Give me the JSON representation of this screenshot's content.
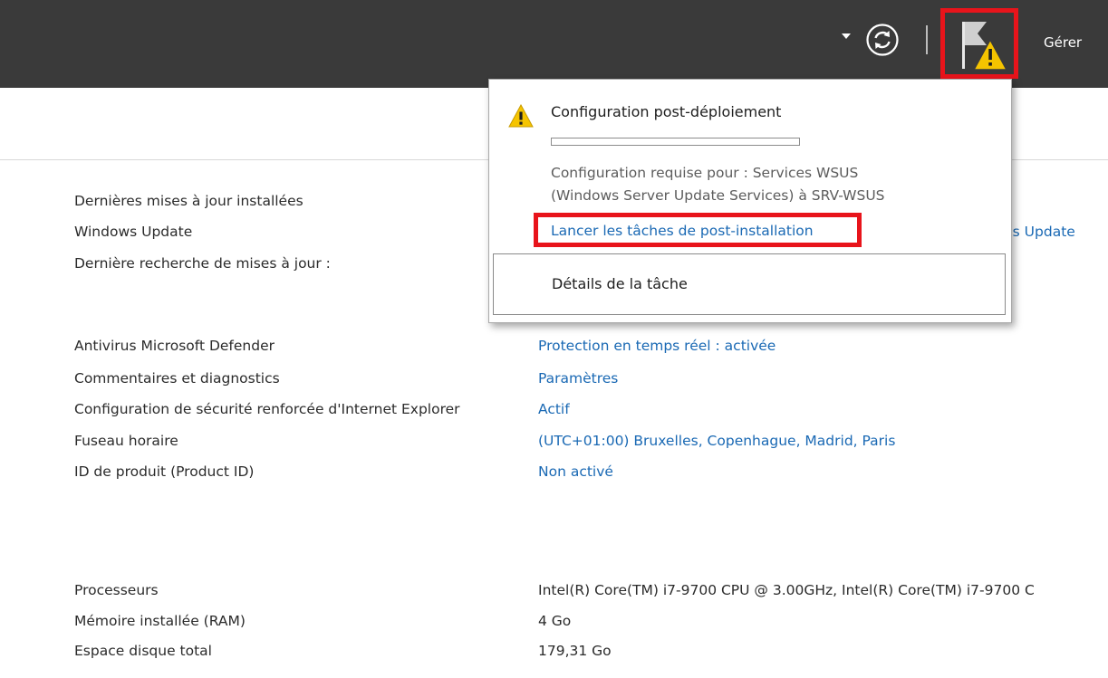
{
  "topbar": {
    "manage_label": "Gérer"
  },
  "icons": {
    "dropdown": "triangle-down-icon",
    "refresh": "refresh-icon",
    "notifications": "flag-warning-icon"
  },
  "notification": {
    "title": "Configuration post-déploiement",
    "progress": 0,
    "description_line1": "Configuration requise pour : Services WSUS",
    "description_line2": "(Windows Server Update Services) à SRV-WSUS",
    "action_link": "Lancer les tâches de post-installation",
    "details_button": "Détails de la tâche"
  },
  "update_section": {
    "items": [
      {
        "label": "Dernières mises à jour installées"
      },
      {
        "label": "Windows Update",
        "partial_value": "ws Update"
      },
      {
        "label": "Dernière recherche de mises à jour :"
      }
    ]
  },
  "properties": [
    {
      "label": "Antivirus Microsoft Defender",
      "value": "Protection en temps réel : activée"
    },
    {
      "label": "Commentaires et diagnostics",
      "value": "Paramètres"
    },
    {
      "label": "Configuration de sécurité renforcée d'Internet Explorer",
      "value": "Actif"
    },
    {
      "label": "Fuseau horaire",
      "value": "(UTC+01:00) Bruxelles, Copenhague, Madrid, Paris"
    },
    {
      "label": "ID de produit (Product ID)",
      "value": "Non activé"
    }
  ],
  "hardware": [
    {
      "label": "Processeurs",
      "value": "Intel(R) Core(TM) i7-9700 CPU @ 3.00GHz, Intel(R) Core(TM) i7-9700 C"
    },
    {
      "label": "Mémoire installée (RAM)",
      "value": "4 Go"
    },
    {
      "label": "Espace disque total",
      "value": "179,31 Go"
    }
  ],
  "colors": {
    "topbar": "#3a3a3a",
    "link": "#1a69b4",
    "highlight": "#e8141b",
    "warning": "#f5c400"
  }
}
